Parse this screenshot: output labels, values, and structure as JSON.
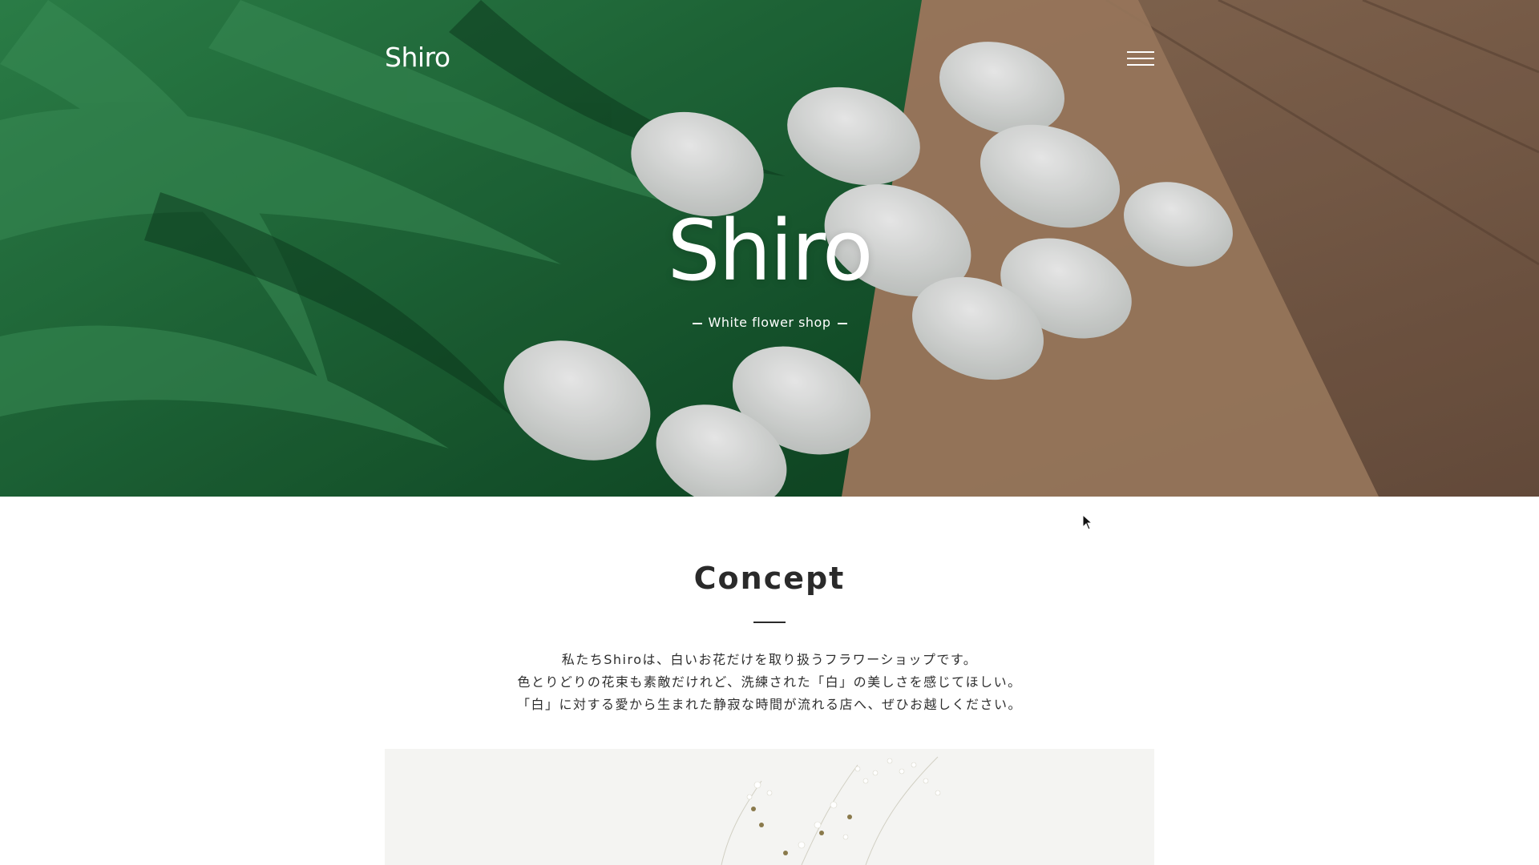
{
  "header": {
    "logo_text": "Shiro",
    "menu_icon": "hamburger-menu-icon"
  },
  "hero": {
    "title": "Shiro",
    "subtitle": "White flower shop"
  },
  "concept": {
    "heading": "Concept",
    "paragraph_lines": [
      "私たちShiroは、白いお花だけを取り扱うフラワーショップです。",
      "色とりどりの花束も素敵だけれど、洗練された「白」の美しさを感じてほしい。",
      "「白」に対する愛から生まれた静寂な時間が流れる店へ、ぜひお越しください。"
    ]
  },
  "colors": {
    "text_dark": "#2a2a2a",
    "hero_leaf_green": "#1f6b3a",
    "hero_wood_brown": "#8a6a52",
    "page_bg": "#ffffff"
  }
}
